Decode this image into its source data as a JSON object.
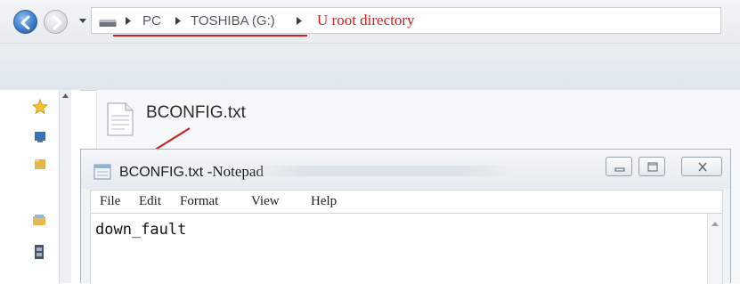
{
  "explorer": {
    "breadcrumb": [
      "PC",
      "TOSHIBA (G:)"
    ],
    "annotation": "U root directory",
    "file_name": "BCONFIG.txt"
  },
  "notepad": {
    "title_file": "BCONFIG.txt",
    "title_app": "-Notepad",
    "menu": [
      "File",
      "Edit",
      "Format",
      "View",
      "Help"
    ],
    "content": "down_fault"
  },
  "colors": {
    "annotation_red": "#d01f1f",
    "back_button_blue": "#3c7ec9"
  },
  "icons": [
    "back-arrow-icon",
    "forward-arrow-icon",
    "dropdown-arrow-icon",
    "drive-icon",
    "star-icon",
    "folder-icon",
    "text-file-icon",
    "notepad-icon",
    "minimize-icon",
    "maximize-icon",
    "close-icon"
  ]
}
